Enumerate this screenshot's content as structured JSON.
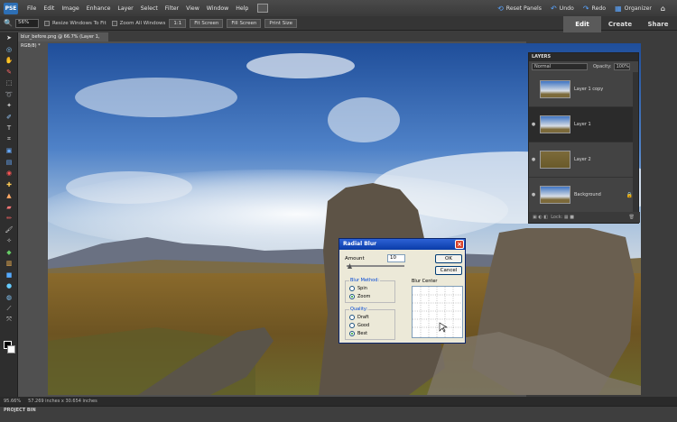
{
  "app": {
    "logo_text": "PSE"
  },
  "menu": [
    "File",
    "Edit",
    "Image",
    "Enhance",
    "Layer",
    "Select",
    "Filter",
    "View",
    "Window",
    "Help"
  ],
  "header_right": {
    "reset_panels": "Reset Panels",
    "undo": "Undo",
    "redo": "Redo",
    "organizer": "Organizer"
  },
  "mode_tabs": {
    "edit": "Edit",
    "create": "Create",
    "share": "Share"
  },
  "options": {
    "zoom": "56%",
    "resize_windows": "Resize Windows To Fit",
    "zoom_all_windows": "Zoom All Windows",
    "actual_pixels": "1:1",
    "fit_screen": "Fit Screen",
    "fill_screen": "Fill Screen",
    "print_size": "Print Size"
  },
  "document": {
    "tab_title": "blur_before.png @ 66.7% (Layer 1, RGB/8) *"
  },
  "status": {
    "zoom": "95.66%",
    "doc_info": "57.269 inches x 30.654 inches"
  },
  "project_bin": {
    "label": "PROJECT BIN"
  },
  "layers_panel": {
    "title": "LAYERS",
    "blend_mode": "Normal",
    "opacity_label": "Opacity:",
    "opacity_value": "100%",
    "layers": [
      {
        "name": "Layer 1 copy",
        "selected": false,
        "visible": false
      },
      {
        "name": "Layer 1",
        "selected": true,
        "visible": true
      },
      {
        "name": "Layer 2",
        "selected": false,
        "visible": true
      },
      {
        "name": "Background",
        "selected": false,
        "visible": true
      }
    ],
    "lock_label": "Lock:"
  },
  "dialog": {
    "title": "Radial Blur",
    "amount_label": "Amount",
    "amount_value": "10",
    "ok": "OK",
    "cancel": "Cancel",
    "blur_method_title": "Blur Method:",
    "spin": "Spin",
    "zoom": "Zoom",
    "selected_method": "Zoom",
    "quality_title": "Quality:",
    "draft": "Draft",
    "good": "Good",
    "best": "Best",
    "selected_quality": "Best",
    "blur_center_label": "Blur Center"
  },
  "colors": {
    "sky": "#3f74c2",
    "accent": "#2d6fb5",
    "dialog_title": "#0a3ca8"
  }
}
